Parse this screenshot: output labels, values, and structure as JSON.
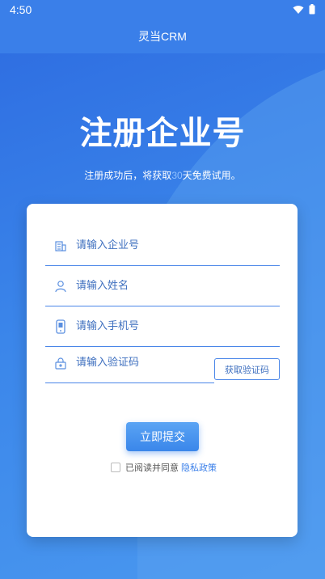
{
  "status_bar": {
    "time": "4:50"
  },
  "app_bar": {
    "title": "灵当CRM"
  },
  "hero": {
    "title": "注册企业号",
    "subtitle_before": "注册成功后，将获取",
    "subtitle_highlight": "30",
    "subtitle_after": "天免费试用。"
  },
  "form": {
    "company": {
      "placeholder": "请输入企业号",
      "value": ""
    },
    "name": {
      "placeholder": "请输入姓名",
      "value": ""
    },
    "phone": {
      "placeholder": "请输入手机号",
      "value": ""
    },
    "code": {
      "placeholder": "请输入验证码",
      "value": ""
    },
    "get_code_label": "获取验证码",
    "submit_label": "立即提交",
    "agree_text": "已阅读并同意",
    "privacy_link": "隐私政策"
  },
  "colors": {
    "primary": "#3a7fe9",
    "accent_input": "#4a86e8"
  }
}
